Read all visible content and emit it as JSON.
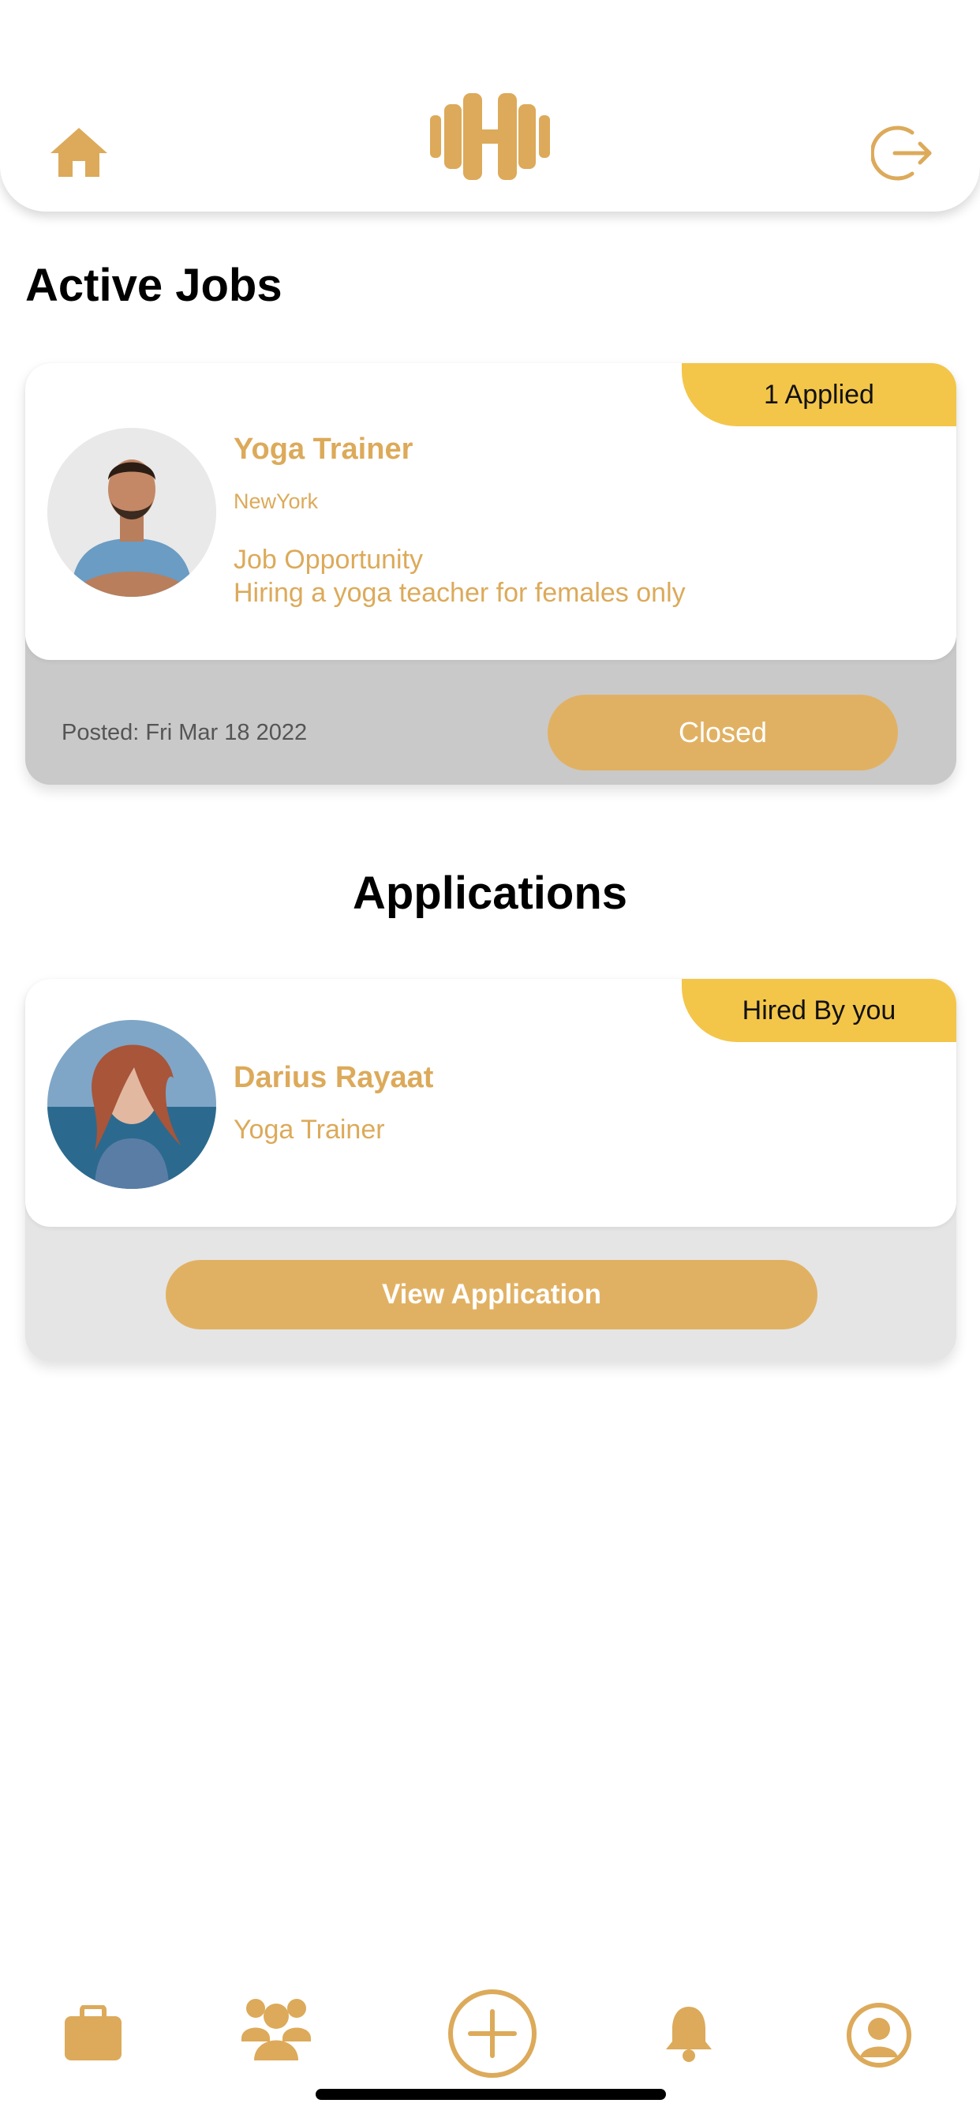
{
  "header": {
    "home_icon": "home-icon",
    "logo_icon": "dumbbell-logo-icon",
    "logout_icon": "logout-icon",
    "accent_color": "#dcaa5a"
  },
  "active_jobs": {
    "title": "Active Jobs",
    "job": {
      "badge": "1 Applied",
      "title": "Yoga Trainer",
      "location": "NewYork",
      "description_line1": "Job Opportunity",
      "description_line2": "Hiring a yoga teacher for females only",
      "posted": "Posted: Fri Mar 18 2022",
      "status_button": "Closed"
    }
  },
  "applications": {
    "title": "Applications",
    "item": {
      "badge": "Hired By you",
      "name": "Darius Rayaat",
      "role": "Yoga Trainer",
      "view_button": "View Application"
    }
  },
  "bottom_nav": {
    "items": [
      "briefcase-icon",
      "group-icon",
      "add-icon",
      "bell-icon",
      "profile-icon"
    ]
  }
}
